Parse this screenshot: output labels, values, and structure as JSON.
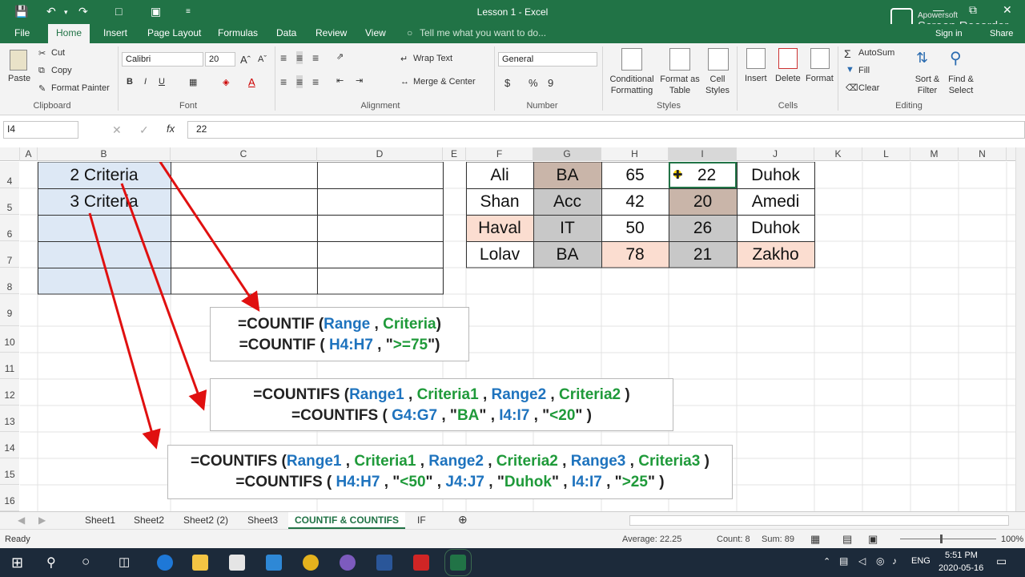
{
  "window": {
    "title": "Lesson 1 - Excel",
    "recorder_brand": "Apowersoft",
    "recorder_name": "Screen Recorder",
    "sign_in": "Sign in",
    "share": "Share"
  },
  "tabs": [
    "File",
    "Home",
    "Insert",
    "Page Layout",
    "Formulas",
    "Data",
    "Review",
    "View"
  ],
  "tell_me": "Tell me what you want to do...",
  "ribbon": {
    "clipboard": {
      "paste": "Paste",
      "cut": "Cut",
      "copy": "Copy",
      "format_painter": "Format Painter",
      "label": "Clipboard"
    },
    "font": {
      "name": "Calibri",
      "size": "20",
      "bold": "B",
      "italic": "I",
      "underline": "U",
      "label": "Font"
    },
    "alignment": {
      "wrap_text": "Wrap Text",
      "merge_center": "Merge & Center",
      "label": "Alignment"
    },
    "number": {
      "format": "General",
      "currency": "$",
      "percent": "%",
      "comma": "9",
      "label": "Number"
    },
    "styles": {
      "conditional": "Conditional Formatting",
      "format_table": "Format as Table",
      "cell_styles": "Cell Styles",
      "label": "Styles"
    },
    "cells": {
      "insert": "Insert",
      "delete": "Delete",
      "format": "Format",
      "label": "Cells"
    },
    "editing": {
      "autosum": "AutoSum",
      "fill": "Fill",
      "clear": "Clear",
      "sort": "Sort & Filter",
      "find": "Find & Select",
      "label": "Editing"
    }
  },
  "formula_bar": {
    "name_box": "I4",
    "fx": "fx",
    "value": "22"
  },
  "columns": [
    "A",
    "B",
    "C",
    "D",
    "E",
    "F",
    "G",
    "H",
    "I",
    "J",
    "K",
    "L",
    "M",
    "N"
  ],
  "rows": [
    "4",
    "5",
    "6",
    "7",
    "8",
    "9",
    "10",
    "11",
    "12",
    "13",
    "14",
    "15",
    "16"
  ],
  "cells_b": [
    "2 Criteria",
    "3 Criteria"
  ],
  "table": [
    {
      "f": "Ali",
      "g": "BA",
      "h": "65",
      "i": "22",
      "j": "Duhok"
    },
    {
      "f": "Shan",
      "g": "Acc",
      "h": "42",
      "i": "20",
      "j": "Amedi"
    },
    {
      "f": "Haval",
      "g": "IT",
      "h": "50",
      "i": "26",
      "j": "Duhok"
    },
    {
      "f": "Lolav",
      "g": "BA",
      "h": "78",
      "i": "21",
      "j": "Zakho"
    }
  ],
  "colors": {
    "excel_green": "#217346",
    "criteria_green": "#1f9a3a",
    "range_blue": "#1e73be",
    "arrow_red": "#e01010",
    "shade_brown": "#c9b5a9",
    "shade_gray": "#c8c8c8",
    "shade_peach": "#fbddd0"
  },
  "formulas": {
    "countif": {
      "l1": {
        "a": "=COUNTIF (",
        "b": "Range",
        "c": " , ",
        "d": "Criteria",
        "e": ")"
      },
      "l2": {
        "a": "=COUNTIF ( ",
        "b": "H4:H7",
        "c": " , \"",
        "d": ">=75",
        "e": "\")"
      }
    },
    "countifs2": {
      "l1": {
        "a": "=COUNTIFS (",
        "b": "Range1",
        "c": " , ",
        "d": "Criteria1",
        "e": " , ",
        "f": "Range2",
        "g": " , ",
        "h": "Criteria2",
        "i": "  )"
      },
      "l2": {
        "a": "=COUNTIFS ( ",
        "b": "G4:G7",
        "c": " , \"",
        "d": "BA",
        "e": "\" , ",
        "f": "I4:I7",
        "g": " , \"",
        "h": "<20",
        "i": "\" )"
      }
    },
    "countifs3": {
      "l1": {
        "a": "=COUNTIFS (",
        "b": "Range1",
        "c": " , ",
        "d": "Criteria1",
        "e": " , ",
        "f": "Range2",
        "g": " , ",
        "h": "Criteria2",
        "i": " , ",
        "j": "Range3",
        "k": " , ",
        "l": "Criteria3",
        "m": "  )"
      },
      "l2": {
        "a": "=COUNTIFS ( ",
        "b": "H4:H7",
        "c": " , \"",
        "d": "<50",
        "e": "\" , ",
        "f": "J4:J7",
        "g": " , \"",
        "h": "Duhok",
        "i": "\" , ",
        "j": "I4:I7",
        "k": " , \"",
        "l": ">25",
        "m": "\" )"
      }
    }
  },
  "sheets": [
    "Sheet1",
    "Sheet2",
    "Sheet2 (2)",
    "Sheet3",
    "COUNTIF & COUNTIFS",
    "IF"
  ],
  "status": {
    "ready": "Ready",
    "average": "Average: 22.25",
    "count": "Count: 8",
    "sum": "Sum: 89",
    "zoom": "100%"
  },
  "taskbar": {
    "lang": "ENG",
    "time": "5:51 PM",
    "date": "2020-05-16"
  }
}
